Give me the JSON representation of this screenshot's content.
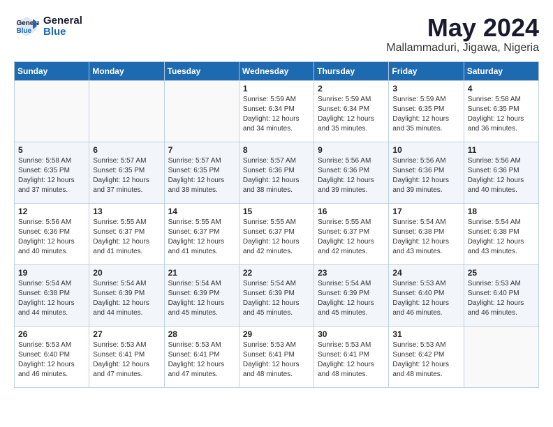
{
  "header": {
    "logo_line1": "General",
    "logo_line2": "Blue",
    "month_year": "May 2024",
    "location": "Mallammaduri, Jigawa, Nigeria"
  },
  "weekdays": [
    "Sunday",
    "Monday",
    "Tuesday",
    "Wednesday",
    "Thursday",
    "Friday",
    "Saturday"
  ],
  "weeks": [
    [
      {
        "day": "",
        "sunrise": "",
        "sunset": "",
        "daylight": ""
      },
      {
        "day": "",
        "sunrise": "",
        "sunset": "",
        "daylight": ""
      },
      {
        "day": "",
        "sunrise": "",
        "sunset": "",
        "daylight": ""
      },
      {
        "day": "1",
        "sunrise": "Sunrise: 5:59 AM",
        "sunset": "Sunset: 6:34 PM",
        "daylight": "Daylight: 12 hours and 34 minutes."
      },
      {
        "day": "2",
        "sunrise": "Sunrise: 5:59 AM",
        "sunset": "Sunset: 6:34 PM",
        "daylight": "Daylight: 12 hours and 35 minutes."
      },
      {
        "day": "3",
        "sunrise": "Sunrise: 5:59 AM",
        "sunset": "Sunset: 6:35 PM",
        "daylight": "Daylight: 12 hours and 35 minutes."
      },
      {
        "day": "4",
        "sunrise": "Sunrise: 5:58 AM",
        "sunset": "Sunset: 6:35 PM",
        "daylight": "Daylight: 12 hours and 36 minutes."
      }
    ],
    [
      {
        "day": "5",
        "sunrise": "Sunrise: 5:58 AM",
        "sunset": "Sunset: 6:35 PM",
        "daylight": "Daylight: 12 hours and 37 minutes."
      },
      {
        "day": "6",
        "sunrise": "Sunrise: 5:57 AM",
        "sunset": "Sunset: 6:35 PM",
        "daylight": "Daylight: 12 hours and 37 minutes."
      },
      {
        "day": "7",
        "sunrise": "Sunrise: 5:57 AM",
        "sunset": "Sunset: 6:35 PM",
        "daylight": "Daylight: 12 hours and 38 minutes."
      },
      {
        "day": "8",
        "sunrise": "Sunrise: 5:57 AM",
        "sunset": "Sunset: 6:36 PM",
        "daylight": "Daylight: 12 hours and 38 minutes."
      },
      {
        "day": "9",
        "sunrise": "Sunrise: 5:56 AM",
        "sunset": "Sunset: 6:36 PM",
        "daylight": "Daylight: 12 hours and 39 minutes."
      },
      {
        "day": "10",
        "sunrise": "Sunrise: 5:56 AM",
        "sunset": "Sunset: 6:36 PM",
        "daylight": "Daylight: 12 hours and 39 minutes."
      },
      {
        "day": "11",
        "sunrise": "Sunrise: 5:56 AM",
        "sunset": "Sunset: 6:36 PM",
        "daylight": "Daylight: 12 hours and 40 minutes."
      }
    ],
    [
      {
        "day": "12",
        "sunrise": "Sunrise: 5:56 AM",
        "sunset": "Sunset: 6:36 PM",
        "daylight": "Daylight: 12 hours and 40 minutes."
      },
      {
        "day": "13",
        "sunrise": "Sunrise: 5:55 AM",
        "sunset": "Sunset: 6:37 PM",
        "daylight": "Daylight: 12 hours and 41 minutes."
      },
      {
        "day": "14",
        "sunrise": "Sunrise: 5:55 AM",
        "sunset": "Sunset: 6:37 PM",
        "daylight": "Daylight: 12 hours and 41 minutes."
      },
      {
        "day": "15",
        "sunrise": "Sunrise: 5:55 AM",
        "sunset": "Sunset: 6:37 PM",
        "daylight": "Daylight: 12 hours and 42 minutes."
      },
      {
        "day": "16",
        "sunrise": "Sunrise: 5:55 AM",
        "sunset": "Sunset: 6:37 PM",
        "daylight": "Daylight: 12 hours and 42 minutes."
      },
      {
        "day": "17",
        "sunrise": "Sunrise: 5:54 AM",
        "sunset": "Sunset: 6:38 PM",
        "daylight": "Daylight: 12 hours and 43 minutes."
      },
      {
        "day": "18",
        "sunrise": "Sunrise: 5:54 AM",
        "sunset": "Sunset: 6:38 PM",
        "daylight": "Daylight: 12 hours and 43 minutes."
      }
    ],
    [
      {
        "day": "19",
        "sunrise": "Sunrise: 5:54 AM",
        "sunset": "Sunset: 6:38 PM",
        "daylight": "Daylight: 12 hours and 44 minutes."
      },
      {
        "day": "20",
        "sunrise": "Sunrise: 5:54 AM",
        "sunset": "Sunset: 6:39 PM",
        "daylight": "Daylight: 12 hours and 44 minutes."
      },
      {
        "day": "21",
        "sunrise": "Sunrise: 5:54 AM",
        "sunset": "Sunset: 6:39 PM",
        "daylight": "Daylight: 12 hours and 45 minutes."
      },
      {
        "day": "22",
        "sunrise": "Sunrise: 5:54 AM",
        "sunset": "Sunset: 6:39 PM",
        "daylight": "Daylight: 12 hours and 45 minutes."
      },
      {
        "day": "23",
        "sunrise": "Sunrise: 5:54 AM",
        "sunset": "Sunset: 6:39 PM",
        "daylight": "Daylight: 12 hours and 45 minutes."
      },
      {
        "day": "24",
        "sunrise": "Sunrise: 5:53 AM",
        "sunset": "Sunset: 6:40 PM",
        "daylight": "Daylight: 12 hours and 46 minutes."
      },
      {
        "day": "25",
        "sunrise": "Sunrise: 5:53 AM",
        "sunset": "Sunset: 6:40 PM",
        "daylight": "Daylight: 12 hours and 46 minutes."
      }
    ],
    [
      {
        "day": "26",
        "sunrise": "Sunrise: 5:53 AM",
        "sunset": "Sunset: 6:40 PM",
        "daylight": "Daylight: 12 hours and 46 minutes."
      },
      {
        "day": "27",
        "sunrise": "Sunrise: 5:53 AM",
        "sunset": "Sunset: 6:41 PM",
        "daylight": "Daylight: 12 hours and 47 minutes."
      },
      {
        "day": "28",
        "sunrise": "Sunrise: 5:53 AM",
        "sunset": "Sunset: 6:41 PM",
        "daylight": "Daylight: 12 hours and 47 minutes."
      },
      {
        "day": "29",
        "sunrise": "Sunrise: 5:53 AM",
        "sunset": "Sunset: 6:41 PM",
        "daylight": "Daylight: 12 hours and 48 minutes."
      },
      {
        "day": "30",
        "sunrise": "Sunrise: 5:53 AM",
        "sunset": "Sunset: 6:41 PM",
        "daylight": "Daylight: 12 hours and 48 minutes."
      },
      {
        "day": "31",
        "sunrise": "Sunrise: 5:53 AM",
        "sunset": "Sunset: 6:42 PM",
        "daylight": "Daylight: 12 hours and 48 minutes."
      },
      {
        "day": "",
        "sunrise": "",
        "sunset": "",
        "daylight": ""
      }
    ]
  ]
}
